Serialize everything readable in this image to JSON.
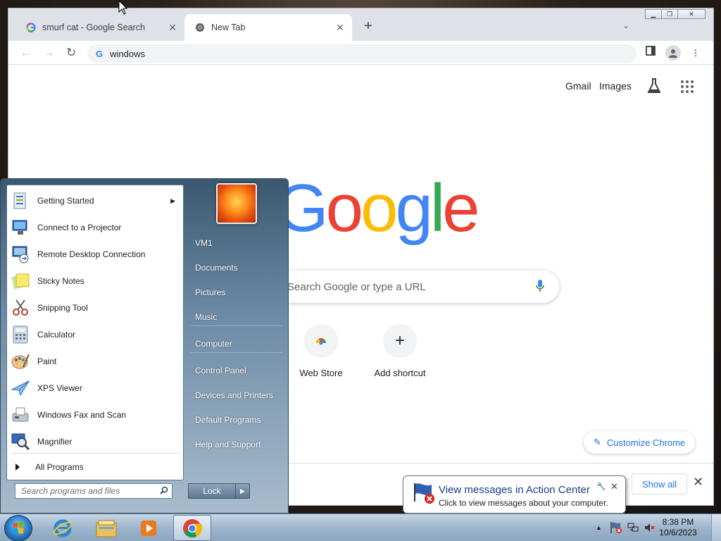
{
  "browser": {
    "tabs": [
      {
        "title": "smurf cat - Google Search",
        "icon": "google-g-icon",
        "active": false
      },
      {
        "title": "New Tab",
        "icon": "chrome-icon",
        "active": true
      }
    ],
    "new_tab_symbol": "+",
    "address": "windows",
    "gbar": {
      "gmail": "Gmail",
      "images": "Images"
    },
    "logo": "Google",
    "search_placeholder": "Search Google or type a URL",
    "shortcuts": [
      {
        "label": "Web Store",
        "icon": "web-store-icon"
      },
      {
        "label": "Add shortcut",
        "icon": "plus-icon",
        "symbol": "+"
      }
    ],
    "customize_label": "Customize Chrome",
    "show_all_label": "Show all"
  },
  "start_menu": {
    "programs": [
      {
        "label": "Getting Started",
        "icon": "getting-started-icon",
        "submenu": true
      },
      {
        "label": "Connect to a Projector",
        "icon": "projector-icon"
      },
      {
        "label": "Remote Desktop Connection",
        "icon": "remote-desktop-icon"
      },
      {
        "label": "Sticky Notes",
        "icon": "sticky-notes-icon"
      },
      {
        "label": "Snipping Tool",
        "icon": "scissors-icon"
      },
      {
        "label": "Calculator",
        "icon": "calculator-icon"
      },
      {
        "label": "Paint",
        "icon": "paint-palette-icon"
      },
      {
        "label": "XPS Viewer",
        "icon": "xps-viewer-icon"
      },
      {
        "label": "Windows Fax and Scan",
        "icon": "fax-icon"
      },
      {
        "label": "Magnifier",
        "icon": "magnifier-icon"
      }
    ],
    "all_programs": "All Programs",
    "search_placeholder": "Search programs and files",
    "right_links": [
      "VM1",
      "Documents",
      "Pictures",
      "Music",
      "Computer",
      "Control Panel",
      "Devices and Printers",
      "Default Programs",
      "Help and Support"
    ],
    "lock_label": "Lock"
  },
  "notification": {
    "title": "View messages in Action Center",
    "text": "Click to view messages about your computer."
  },
  "taskbar": {
    "apps": [
      "internet-explorer-icon",
      "windows-explorer-icon",
      "media-player-icon",
      "chrome-icon"
    ],
    "time": "8:38 PM",
    "date": "10/6/2023"
  },
  "colors": {
    "google_blue": "#4285F4",
    "google_red": "#EA4335",
    "google_yellow": "#FBBC05",
    "google_green": "#34A853",
    "chrome_accent": "#1A73E8",
    "taskbar": "#9EB5CC"
  }
}
